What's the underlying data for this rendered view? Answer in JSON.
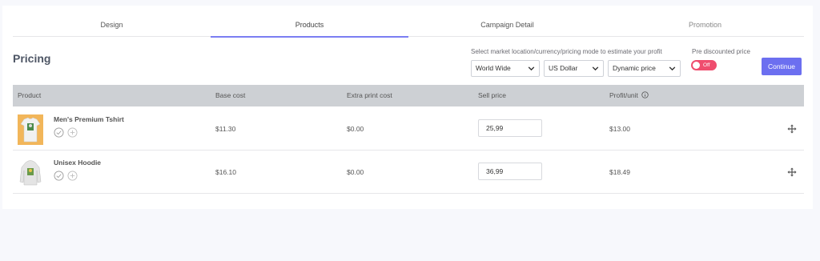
{
  "tabs": [
    {
      "label": "Design"
    },
    {
      "label": "Products"
    },
    {
      "label": "Campaign Detail"
    },
    {
      "label": "Promotion"
    }
  ],
  "active_tab": "Products",
  "pricing": {
    "title": "Pricing",
    "estimate_label": "Select market location/currency/pricing mode to estimate your profit",
    "market_select": "World Wide",
    "currency_select": "US Dollar",
    "mode_select": "Dynamic price",
    "pre_discount_label": "Pre discounted price",
    "toggle_text": "Off",
    "continue_label": "Continue"
  },
  "table": {
    "headers": {
      "product": "Product",
      "base_cost": "Base cost",
      "extra_print": "Extra print cost",
      "sell_price": "Sell price",
      "profit": "Profit/unit"
    },
    "rows": [
      {
        "name": "Men's Premium Tshirt",
        "base_cost": "$11.30",
        "extra_print": "$0.00",
        "sell_price": "25,99",
        "profit": "$13.00"
      },
      {
        "name": "Unisex Hoodie",
        "base_cost": "$16.10",
        "extra_print": "$0.00",
        "sell_price": "36,99",
        "profit": "$18.49"
      }
    ]
  },
  "colors": {
    "accent": "#6c6ff0",
    "toggle_off": "#ef4d6e",
    "table_header": "#cdd0d4"
  }
}
